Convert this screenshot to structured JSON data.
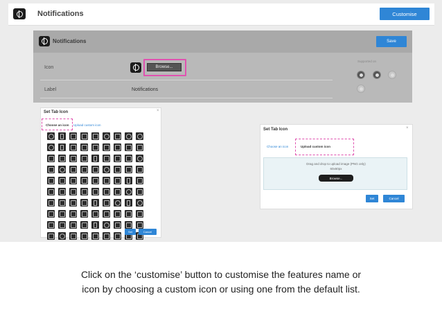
{
  "app": {
    "title": "Notifications",
    "customise_label": "Customise"
  },
  "dialog": {
    "title": "Notifications",
    "save_label": "Save",
    "icon_label": "Icon",
    "browse_label": "Browse...",
    "label_label": "Label",
    "label_value": "Notifications",
    "supported_on": "Supported on"
  },
  "set_tab_icon_left": {
    "title": "Set Tab Icon",
    "close": "×",
    "tab_choose": "Choose an icon",
    "tab_upload": "Upload custom icon",
    "set_label": "Set",
    "cancel_label": "Cancel"
  },
  "set_tab_icon_right": {
    "title": "Set Tab Icon",
    "close": "×",
    "tab_choose": "Choose an icon",
    "tab_upload": "Upload custom icon",
    "drop_text": "Drag and drop to upload image (PNG only)",
    "size_text": "60x60px",
    "browse_label": "Browse...",
    "set_label": "Set",
    "cancel_label": "Cancel"
  },
  "caption": {
    "line1": "Click on the ‘customise’ button to customise the features name or",
    "line2": "icon by choosing a custom icon or using one from the default list."
  },
  "colors": {
    "accent": "#2f86d6",
    "highlight": "#e052b0"
  }
}
